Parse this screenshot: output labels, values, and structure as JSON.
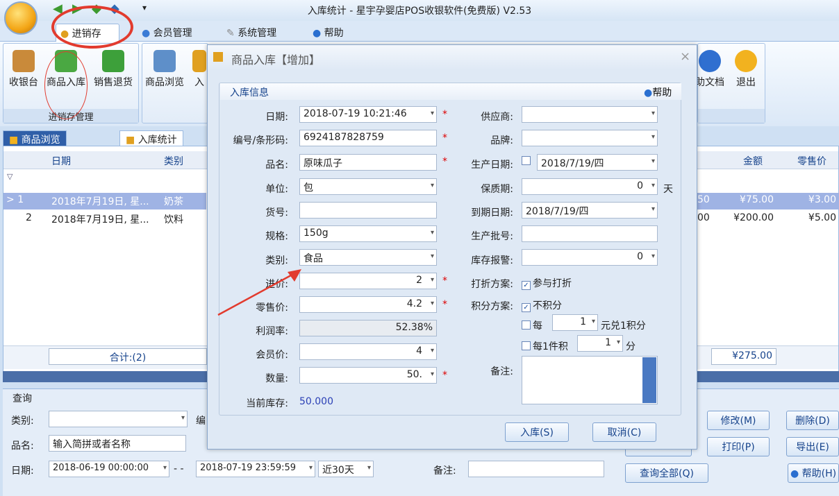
{
  "window": {
    "title": "入库统计 - 星宇孕婴店POS收银软件(免费版) V2.53"
  },
  "ribbon": {
    "tabs": [
      "进销存",
      "会员管理",
      "系统管理",
      "帮助"
    ],
    "group1": {
      "buttons": [
        "收银台",
        "商品入库",
        "销售退货"
      ],
      "label": "进销存管理"
    },
    "group2": {
      "buttons": [
        "商品浏览",
        "入"
      ]
    },
    "right_buttons": [
      "助文档",
      "退出"
    ]
  },
  "doc_tabs": [
    "商品浏览",
    "入库统计"
  ],
  "grid": {
    "headers": [
      "日期",
      "类别",
      "金额",
      "零售价"
    ],
    "filter_icon": "funnel-icon",
    "rows": [
      {
        "num": "1",
        "date": "2018年7月19日, 星...",
        "cat": "奶茶",
        "p": "50",
        "amount": "¥75.00",
        "retail": "¥3.00"
      },
      {
        "num": "2",
        "date": "2018年7月19日, 星...",
        "cat": "饮料",
        "p": "00",
        "amount": "¥200.00",
        "retail": "¥5.00"
      }
    ],
    "total_label": "合计:(2)",
    "total_amount": "¥275.00"
  },
  "query": {
    "title": "查询",
    "cat_label": "类别:",
    "code_label": "编",
    "name_label": "品名:",
    "name_placeholder": "输入简拼或者名称",
    "date_label": "日期:",
    "date_from": "2018-06-19 00:00:00",
    "sep": "- -",
    "date_to": "2018-07-19 23:59:59",
    "range": "近30天",
    "note_label": "备注:",
    "btn_modify": "修改(M)",
    "btn_delete": "删除(D)",
    "btn_print": "打印(P)",
    "btn_export": "导出(E)",
    "btn_all": "查询全部(Q)",
    "btn_help": "帮助(H)"
  },
  "dialog": {
    "title": "商品入库【增加】",
    "section": "入库信息",
    "help": "帮助",
    "date_label": "日期:",
    "date": "2018-07-19 10:21:46",
    "code_label": "编号/条形码:",
    "code": "6924187828759",
    "name_label": "品名:",
    "name": "原味瓜子",
    "unit_label": "单位:",
    "unit": "包",
    "sku_label": "货号:",
    "sku": "",
    "spec_label": "规格:",
    "spec": "150g",
    "cat_label": "类别:",
    "cat": "食品",
    "cost_label": "进价:",
    "cost": "2",
    "retail_label": "零售价:",
    "retail": "4.2",
    "margin_label": "利润率:",
    "margin": "52.38%",
    "member_label": "会员价:",
    "member": "4",
    "qty_label": "数量:",
    "qty": "50.",
    "stock_label": "当前库存:",
    "stock": "50.000",
    "supplier_label": "供应商:",
    "brand_label": "品牌:",
    "mfg_label": "生产日期:",
    "mfg": "2018/7/19/四",
    "shelf_label": "保质期:",
    "shelf": "0",
    "shelf_unit": "天",
    "exp_label": "到期日期:",
    "exp": "2018/7/19/四",
    "batch_label": "生产批号:",
    "alarm_label": "库存报警:",
    "alarm": "0",
    "disc_label": "打折方案:",
    "disc_opt": "参与打折",
    "points_label": "积分方案:",
    "points_opt": "不积分",
    "every": "每",
    "every_val": "1",
    "yuan": "元兑1积分",
    "per_item": "每1件积",
    "per_val": "1",
    "fen": "分",
    "remark_label": "备注:",
    "ok": "入库(S)",
    "cancel": "取消(C)",
    "close": "×"
  },
  "colors": {
    "ribbon_bg": "#dbe8f7",
    "accent_red": "#e23b2e",
    "link_blue": "#15428b"
  }
}
